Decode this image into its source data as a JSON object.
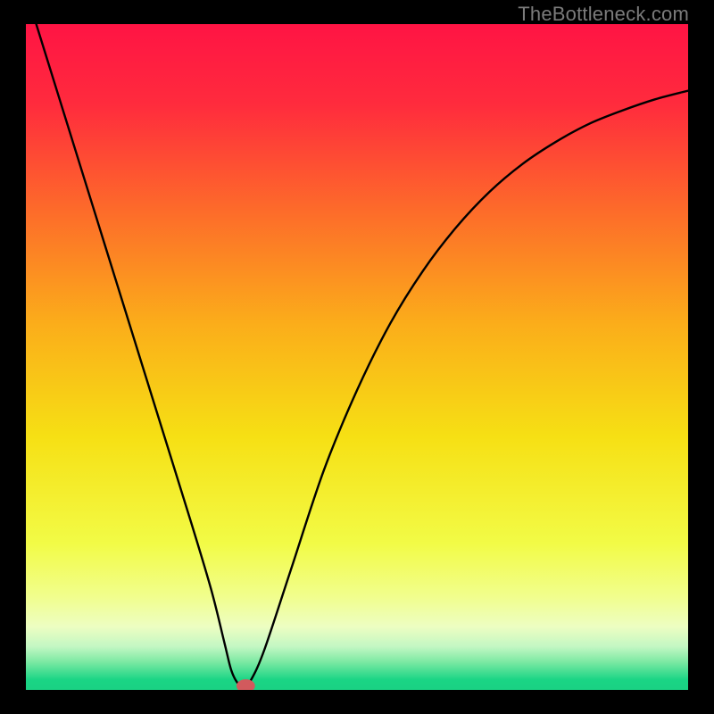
{
  "watermark": {
    "text": "TheBottleneck.com"
  },
  "chart_data": {
    "type": "line",
    "title": "",
    "xlabel": "",
    "ylabel": "",
    "xlim": [
      0,
      100
    ],
    "ylim": [
      0,
      100
    ],
    "grid": false,
    "legend": false,
    "gradient_stops": [
      {
        "offset": 0.0,
        "color": "#ff1444"
      },
      {
        "offset": 0.12,
        "color": "#ff2b3d"
      },
      {
        "offset": 0.28,
        "color": "#fd6b2a"
      },
      {
        "offset": 0.45,
        "color": "#fbad1a"
      },
      {
        "offset": 0.62,
        "color": "#f6e014"
      },
      {
        "offset": 0.78,
        "color": "#f2fb46"
      },
      {
        "offset": 0.86,
        "color": "#f1fe8d"
      },
      {
        "offset": 0.905,
        "color": "#edfec2"
      },
      {
        "offset": 0.935,
        "color": "#c3f7c3"
      },
      {
        "offset": 0.958,
        "color": "#7ce9a3"
      },
      {
        "offset": 0.985,
        "color": "#1ad585"
      },
      {
        "offset": 1.0,
        "color": "#1ad183"
      }
    ],
    "series": [
      {
        "name": "bottleneck-curve",
        "x": [
          0,
          5,
          10,
          15,
          20,
          25,
          28,
          30,
          31,
          32,
          33,
          34,
          36,
          40,
          45,
          50,
          55,
          60,
          65,
          70,
          75,
          80,
          85,
          90,
          95,
          100
        ],
        "y": [
          105,
          89,
          73,
          57,
          41,
          25,
          15,
          7,
          3,
          1,
          0.5,
          1.5,
          6,
          18,
          33,
          45,
          55,
          63,
          69.5,
          74.8,
          79,
          82.3,
          85,
          87,
          88.7,
          90
        ]
      }
    ],
    "marker": {
      "x": 33.2,
      "y": 0.6,
      "rx": 1.4,
      "ry": 1.0,
      "color": "#d25a5d"
    }
  }
}
